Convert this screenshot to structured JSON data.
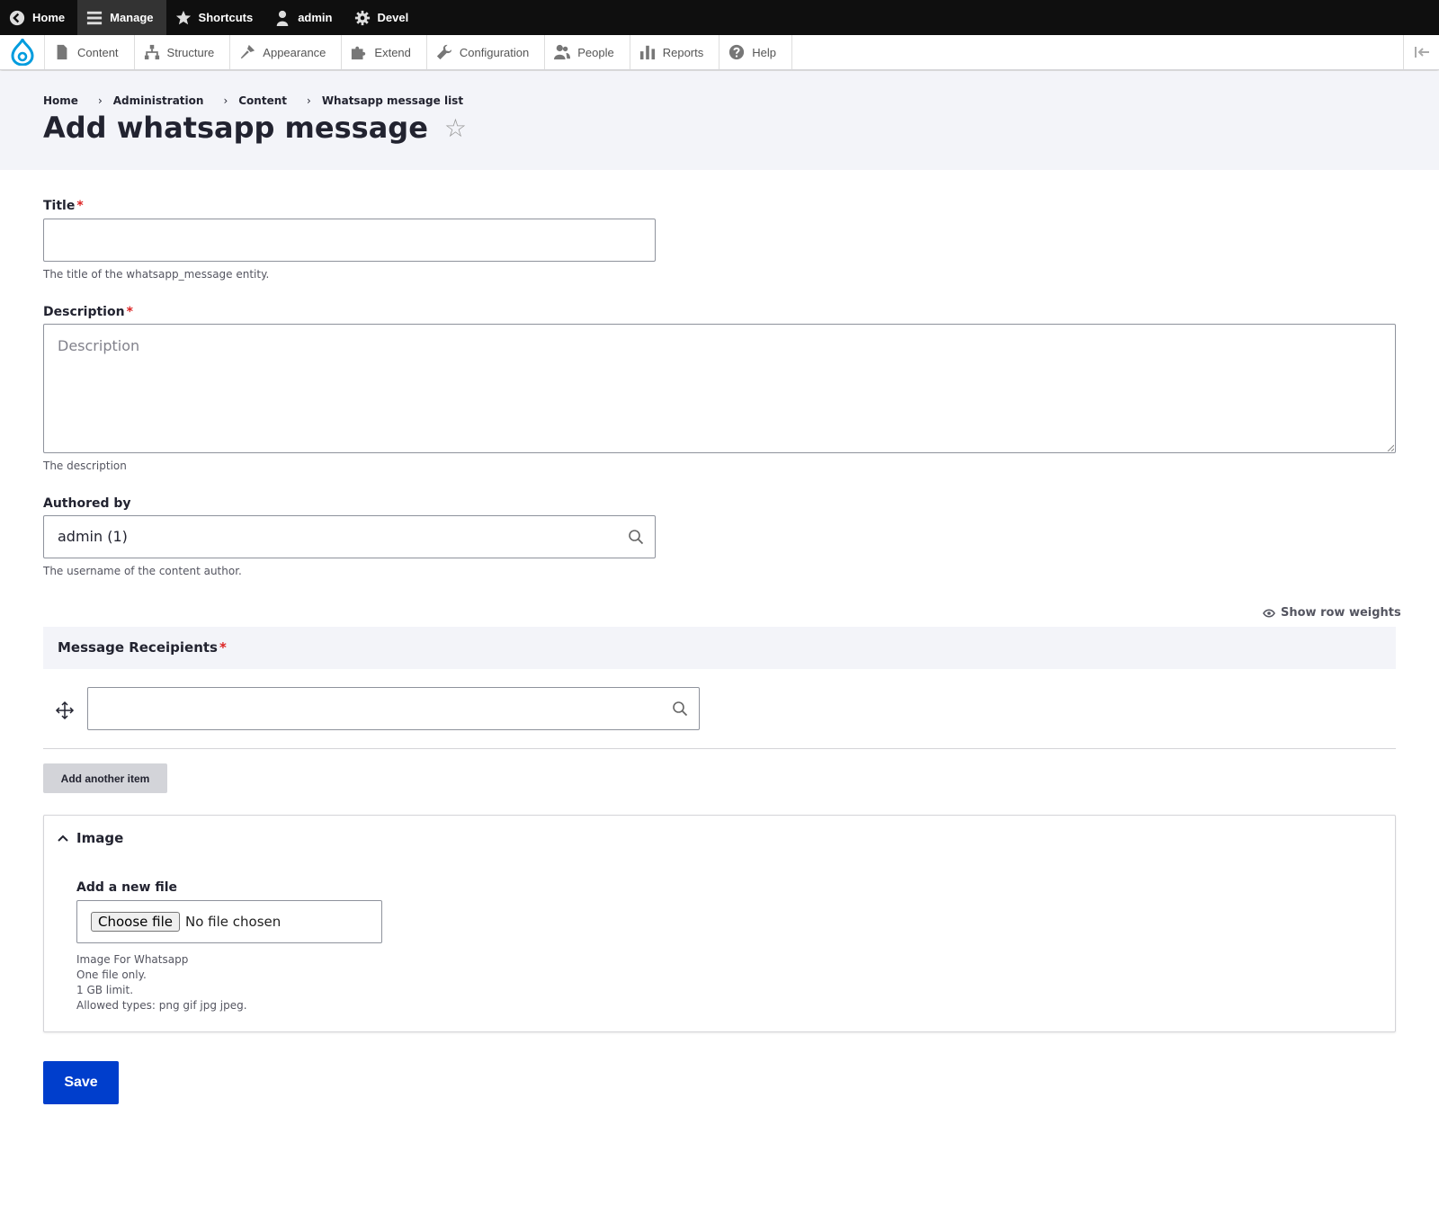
{
  "toolbar": {
    "home": "Home",
    "manage": "Manage",
    "shortcuts": "Shortcuts",
    "user": "admin",
    "devel": "Devel"
  },
  "tray": {
    "items": [
      "Content",
      "Structure",
      "Appearance",
      "Extend",
      "Configuration",
      "People",
      "Reports",
      "Help"
    ]
  },
  "breadcrumb": [
    "Home",
    "Administration",
    "Content",
    "Whatsapp message list"
  ],
  "page_title": "Add whatsapp message",
  "form": {
    "title_label": "Title",
    "title_value": "",
    "title_desc": "The title of the whatsapp_message entity.",
    "description_label": "Description",
    "description_placeholder": "Description",
    "description_desc": "The description",
    "author_label": "Authored by",
    "author_value": "admin (1)",
    "author_desc": "The username of the content author.",
    "row_weights": "Show row weights",
    "recipients_label": "Message Receipients",
    "recipient_value": "",
    "add_another": "Add another item",
    "image_summary": "Image",
    "file_label": "Add a new file",
    "file_button": "Choose file",
    "file_status": "No file chosen",
    "file_help": [
      "Image For Whatsapp",
      "One file only.",
      "1 GB limit.",
      "Allowed types: png gif jpg jpeg."
    ],
    "save": "Save"
  },
  "colors": {
    "primary": "#003ecc",
    "required": "#dc2323",
    "header_bg": "#f3f4f9",
    "toolbar_bg": "#0f0f0f",
    "drupal_blue": "#009cde"
  }
}
